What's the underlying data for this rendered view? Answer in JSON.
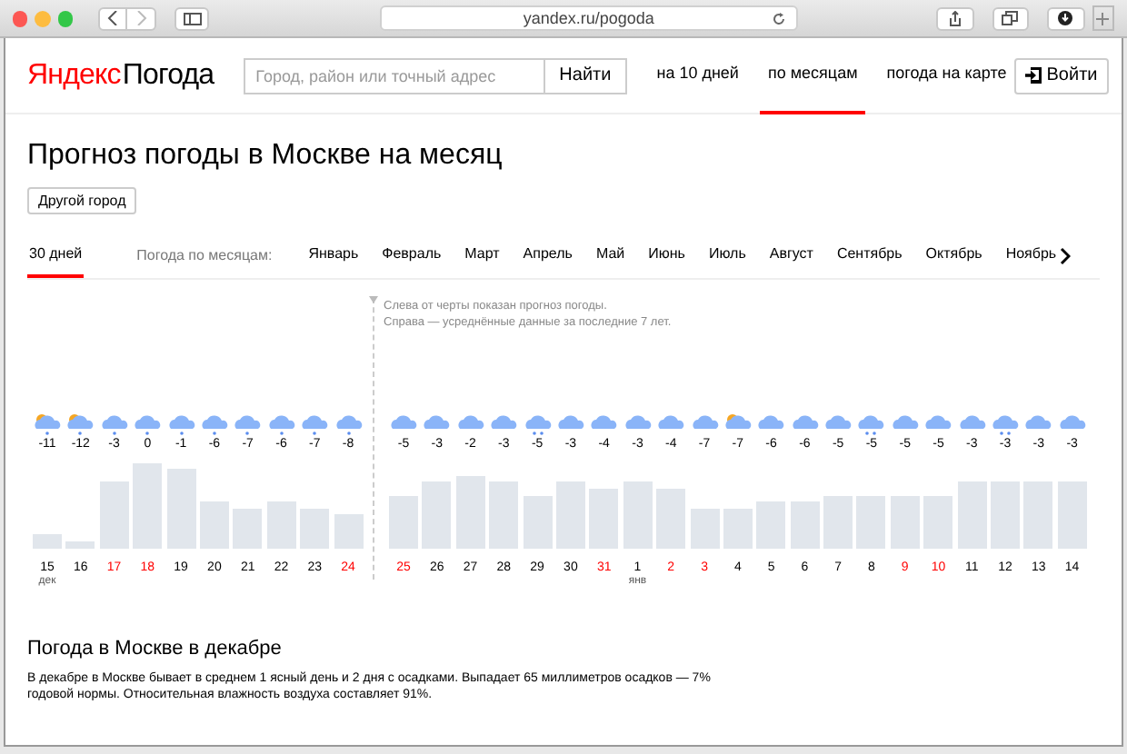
{
  "browser": {
    "address": "yandex.ru/pogoda"
  },
  "header": {
    "logo_brand": "Яндекс",
    "logo_product": "Погода",
    "search": {
      "placeholder": "Город, район или точный адрес",
      "button": "Найти"
    },
    "nav": [
      {
        "label": "на 10 дней",
        "selected": false
      },
      {
        "label": "по месяцам",
        "selected": true
      },
      {
        "label": "погода на карте",
        "selected": false
      }
    ],
    "login": "Войти"
  },
  "title": "Прогноз погоды в Москве на месяц",
  "city_button": "Другой город",
  "month_tabs": {
    "first": {
      "label": "30 дней",
      "selected": true
    },
    "caption": "Погода по месяцам:",
    "months": [
      {
        "label": "Январь",
        "selected": false
      },
      {
        "label": "Февраль",
        "selected": false
      },
      {
        "label": "Март",
        "selected": false
      },
      {
        "label": "Апрель",
        "selected": false
      },
      {
        "label": "Май",
        "selected": false
      },
      {
        "label": "Июнь",
        "selected": false
      },
      {
        "label": "Июль",
        "selected": false
      },
      {
        "label": "Август",
        "selected": false
      },
      {
        "label": "Сентябрь",
        "selected": false
      },
      {
        "label": "Октябрь",
        "selected": false
      },
      {
        "label": "Ноябрь",
        "selected": false
      }
    ]
  },
  "chart_note": [
    "Слева от черты показан прогноз погоды.",
    "Справа — усреднённые данные за последние 7 лет."
  ],
  "forecast_days": [
    {
      "date": "15",
      "month": "дек",
      "temp": "-11",
      "weekend": false,
      "kind": "sun_snow",
      "level": 0.15
    },
    {
      "date": "16",
      "temp": "-12",
      "weekend": false,
      "kind": "sun_snow",
      "level": 0.08
    },
    {
      "date": "17",
      "temp": "-3",
      "weekend": true,
      "kind": "snow",
      "level": 0.73
    },
    {
      "date": "18",
      "temp": "0",
      "weekend": true,
      "kind": "snow",
      "level": 0.94
    },
    {
      "date": "19",
      "temp": "-1",
      "weekend": false,
      "kind": "snow",
      "level": 0.87
    },
    {
      "date": "20",
      "temp": "-6",
      "weekend": false,
      "kind": "snow",
      "level": 0.51
    },
    {
      "date": "21",
      "temp": "-7",
      "weekend": false,
      "kind": "snow",
      "level": 0.44
    },
    {
      "date": "22",
      "temp": "-6",
      "weekend": false,
      "kind": "snow",
      "level": 0.51
    },
    {
      "date": "23",
      "temp": "-7",
      "weekend": false,
      "kind": "snow",
      "level": 0.44
    },
    {
      "date": "24",
      "temp": "-8",
      "weekend": true,
      "kind": "snow",
      "level": 0.37
    }
  ],
  "average_days": [
    {
      "date": "25",
      "temp": "-5",
      "weekend": true,
      "kind": "cloud",
      "level": 0.58
    },
    {
      "date": "26",
      "temp": "-3",
      "weekend": false,
      "kind": "cloud",
      "level": 0.73
    },
    {
      "date": "27",
      "temp": "-2",
      "weekend": false,
      "kind": "cloud",
      "level": 0.8
    },
    {
      "date": "28",
      "temp": "-3",
      "weekend": false,
      "kind": "cloud",
      "level": 0.73
    },
    {
      "date": "29",
      "temp": "-5",
      "weekend": false,
      "kind": "snow_heavy",
      "level": 0.58
    },
    {
      "date": "30",
      "temp": "-3",
      "weekend": false,
      "kind": "cloud",
      "level": 0.73
    },
    {
      "date": "31",
      "temp": "-4",
      "weekend": true,
      "kind": "cloud",
      "level": 0.65
    },
    {
      "date": "1",
      "month": "янв",
      "temp": "-3",
      "weekend": false,
      "kind": "cloud",
      "level": 0.73
    },
    {
      "date": "2",
      "temp": "-4",
      "weekend": true,
      "kind": "cloud",
      "level": 0.65
    },
    {
      "date": "3",
      "temp": "-7",
      "weekend": true,
      "kind": "cloud",
      "level": 0.44
    },
    {
      "date": "4",
      "temp": "-7",
      "weekend": false,
      "kind": "sun_cloud",
      "level": 0.44
    },
    {
      "date": "5",
      "temp": "-6",
      "weekend": false,
      "kind": "cloud",
      "level": 0.51
    },
    {
      "date": "6",
      "temp": "-6",
      "weekend": false,
      "kind": "cloud",
      "level": 0.51
    },
    {
      "date": "7",
      "temp": "-5",
      "weekend": false,
      "kind": "cloud",
      "level": 0.58
    },
    {
      "date": "8",
      "temp": "-5",
      "weekend": false,
      "kind": "snow_heavy",
      "level": 0.58
    },
    {
      "date": "9",
      "temp": "-5",
      "weekend": true,
      "kind": "cloud",
      "level": 0.58
    },
    {
      "date": "10",
      "temp": "-5",
      "weekend": true,
      "kind": "cloud",
      "level": 0.58
    },
    {
      "date": "11",
      "temp": "-3",
      "weekend": false,
      "kind": "cloud",
      "level": 0.73
    },
    {
      "date": "12",
      "temp": "-3",
      "weekend": false,
      "kind": "snow_heavy",
      "level": 0.73
    },
    {
      "date": "13",
      "temp": "-3",
      "weekend": false,
      "kind": "cloud",
      "level": 0.73
    },
    {
      "date": "14",
      "temp": "-3",
      "weekend": false,
      "kind": "cloud",
      "level": 0.73
    }
  ],
  "summary": {
    "heading": "Погода в Москве в декабре",
    "text": "В декабре в Москве бывает в среднем 1 ясный день и 2 дня с осадками. Выпадает 65 миллиметров осадков — 7% годовой нормы. Относительная влажность воздуха составляет 91%."
  }
}
